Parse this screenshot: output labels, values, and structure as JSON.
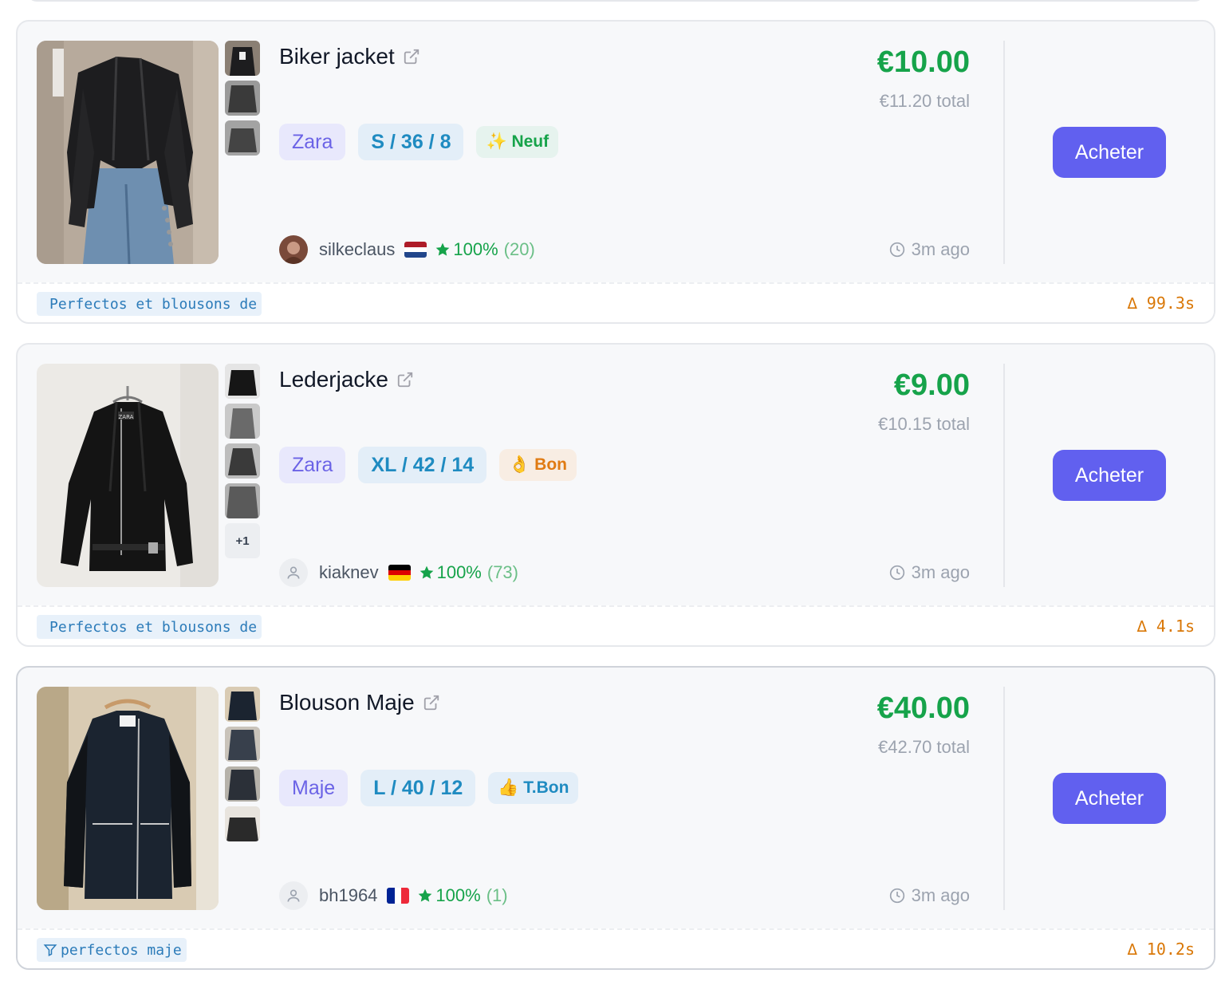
{
  "listings": [
    {
      "title": "Biker jacket",
      "brand": "Zara",
      "size": "S / 36 / 8",
      "condition": "✨ Neuf",
      "seller": "silkeclaus",
      "country_flag": "NL",
      "rating": "100%",
      "rating_count": "(20)",
      "price": "€10.00",
      "total": "€11.20 total",
      "time": "3m ago",
      "buy_label": "Acheter",
      "query": "Perfectos et blousons de",
      "delta": "∆ 99.3s"
    },
    {
      "title": "Lederjacke",
      "brand": "Zara",
      "size": "XL / 42 / 14",
      "condition": "👌 Bon",
      "seller": "kiaknev",
      "country_flag": "DE",
      "rating": "100%",
      "rating_count": "(73)",
      "price": "€9.00",
      "total": "€10.15 total",
      "time": "3m ago",
      "buy_label": "Acheter",
      "more_photos": "+1",
      "query": "Perfectos et blousons de",
      "delta": "∆ 4.1s"
    },
    {
      "title": "Blouson Maje",
      "brand": "Maje",
      "size": "L / 40 / 12",
      "condition": "👍 T.Bon",
      "seller": "bh1964",
      "country_flag": "FR",
      "rating": "100%",
      "rating_count": "(1)",
      "price": "€40.00",
      "total": "€42.70 total",
      "time": "3m ago",
      "buy_label": "Acheter",
      "query": "perfectos maje",
      "delta": "∆ 10.2s"
    }
  ],
  "colors": {
    "price": "#16a34a",
    "button": "#6160ef",
    "brand_tag": "#6b63e6",
    "size_tag": "#1f8bc1",
    "delta": "#d97706"
  }
}
